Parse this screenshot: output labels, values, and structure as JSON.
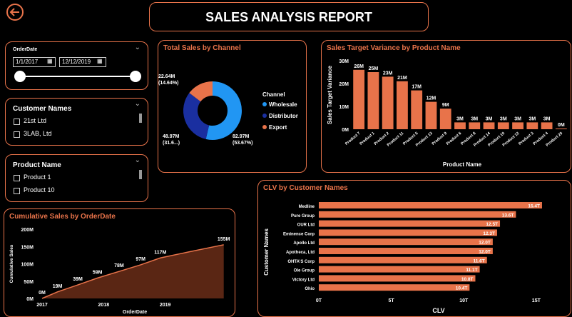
{
  "title": "SALES ANALYSIS REPORT",
  "date_slicer": {
    "label": "OrderDate",
    "start": "1/1/2017",
    "end": "12/12/2019"
  },
  "customer_slicer": {
    "title": "Customer Names",
    "items": [
      "21st Ltd",
      "3LAB, Ltd"
    ]
  },
  "product_slicer": {
    "title": "Product Name",
    "items": [
      "Product 1",
      "Product 10"
    ]
  },
  "colors": {
    "accent": "#e8734a",
    "wholesale": "#2196f3",
    "distributor": "#1a2fa0",
    "export": "#e8734a"
  },
  "chart_data": [
    {
      "id": "channel",
      "type": "pie",
      "title": "Total Sales by Channel",
      "legend_title": "Channel",
      "labels": [
        "Wholesale",
        "Distributor",
        "Export"
      ],
      "values": [
        82.97,
        48.97,
        22.64
      ],
      "value_labels": [
        "82.97M",
        "48.97M",
        "22.64M"
      ],
      "pct_labels": [
        "(53.67%)",
        "(31.6...)",
        "(14.64%)"
      ],
      "legend_placement": "right"
    },
    {
      "id": "variance",
      "type": "bar",
      "title": "Sales Target Variance by Product Name",
      "xlabel": "Product Name",
      "ylabel": "Sales Target Variance",
      "categories": [
        "Product 7",
        "Product 1",
        "Product 2",
        "Product 11",
        "Product 5",
        "Product 13",
        "Product 9",
        "Product 6",
        "Product 8",
        "Product 14",
        "Product 10",
        "Product 12",
        "Product 3",
        "Product 4",
        "Product 20"
      ],
      "values": [
        26,
        25,
        23,
        21,
        17,
        12,
        9,
        3,
        3,
        3,
        3,
        3,
        3,
        3,
        0
      ],
      "value_labels": [
        "26M",
        "25M",
        "23M",
        "21M",
        "17M",
        "12M",
        "9M",
        "3M",
        "3M",
        "3M",
        "3M",
        "3M",
        "3M",
        "3M",
        "0M"
      ],
      "yticks": [
        "0M",
        "10M",
        "20M",
        "30M"
      ],
      "ylim": [
        0,
        30
      ]
    },
    {
      "id": "cumulative",
      "type": "area",
      "title": "Cumulative Sales by OrderDate",
      "xlabel": "OrderDate",
      "ylabel": "Cumulative Sales",
      "x": [
        2017.0,
        2017.25,
        2017.58,
        2017.9,
        2018.25,
        2018.6,
        2018.92,
        2019.4,
        2019.95
      ],
      "values": [
        0,
        19,
        39,
        59,
        78,
        97,
        117,
        135,
        155
      ],
      "labels": [
        "0M",
        "19M",
        "39M",
        "59M",
        "78M",
        "97M",
        "117M",
        "",
        "155M"
      ],
      "xticks": [
        "2017",
        "2018",
        "2019"
      ],
      "yticks": [
        "0M",
        "50M",
        "100M",
        "150M",
        "200M"
      ],
      "ylim": [
        0,
        200
      ]
    },
    {
      "id": "clv",
      "type": "bar",
      "title": "CLV by Customer Names",
      "xlabel": "CLV",
      "ylabel": "Customer Names",
      "categories": [
        "Medline",
        "Pure Group",
        "OUR Ltd",
        "Eminence Corp",
        "Apollo Ltd",
        "Apotheca, Ltd",
        "OHTA'S Corp",
        "Ole Group",
        "Victory Ltd",
        "Ohio"
      ],
      "values": [
        15.4,
        13.6,
        12.5,
        12.3,
        12.0,
        12.0,
        11.6,
        11.1,
        10.8,
        10.4
      ],
      "value_labels": [
        "15.4T",
        "13.6T",
        "12.5T",
        "12.3T",
        "12.0T",
        "12.0T",
        "11.6T",
        "11.1T",
        "10.8T",
        "10.4T"
      ],
      "xticks": [
        "0T",
        "5T",
        "10T",
        "15T"
      ],
      "xlim": [
        0,
        15.5
      ]
    }
  ]
}
